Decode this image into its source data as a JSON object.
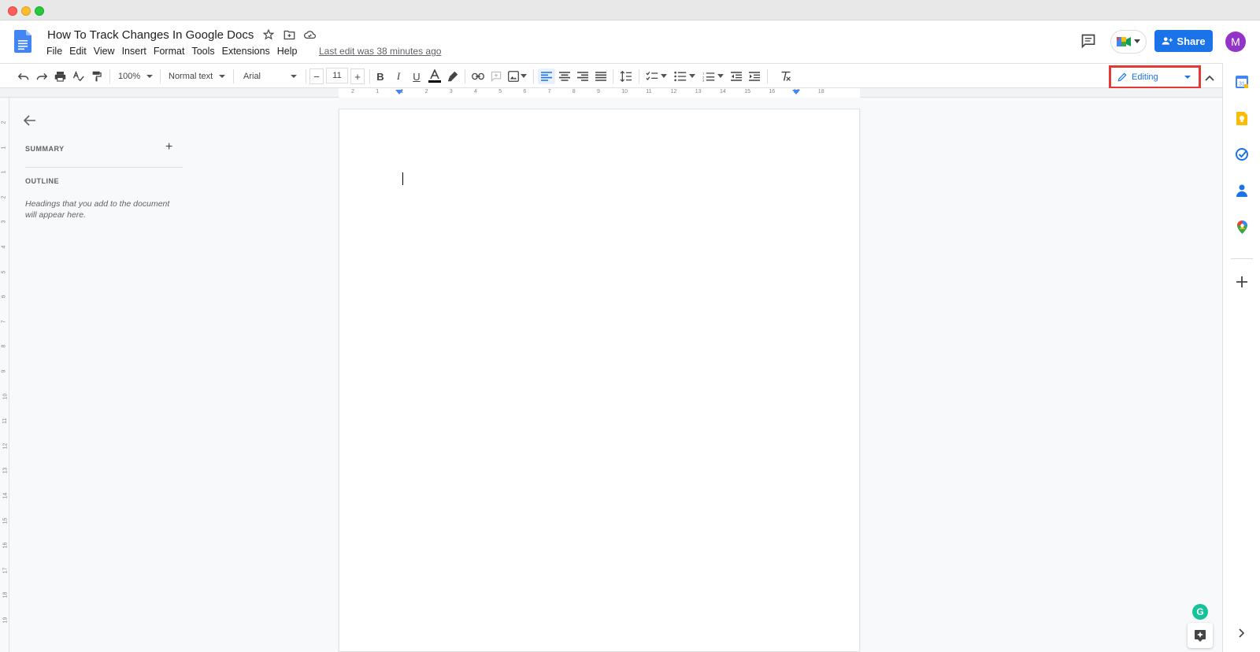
{
  "window": {
    "controls": [
      "close",
      "minimize",
      "maximize"
    ]
  },
  "header": {
    "title": "How To Track Changes In Google Docs",
    "menu": [
      "File",
      "Edit",
      "View",
      "Insert",
      "Format",
      "Tools",
      "Extensions",
      "Help"
    ],
    "last_edit": "Last edit was 38 minutes ago",
    "share_label": "Share",
    "avatar_initial": "M"
  },
  "toolbar": {
    "zoom": "100%",
    "style": "Normal text",
    "font": "Arial",
    "font_size": "11",
    "mode": "Editing",
    "active_alignment": "left"
  },
  "outline": {
    "summary_label": "SUMMARY",
    "summary_add": "+",
    "outline_label": "OUTLINE",
    "hint": "Headings that you add to the document will appear here."
  },
  "ruler": {
    "horizontal": [
      "2",
      "1",
      "1",
      "2",
      "3",
      "4",
      "5",
      "6",
      "7",
      "8",
      "9",
      "10",
      "11",
      "12",
      "13",
      "14",
      "15",
      "16",
      "17",
      "18"
    ],
    "vertical": [
      "2",
      "1",
      "1",
      "2",
      "3",
      "4",
      "5",
      "6",
      "7",
      "8",
      "9",
      "10",
      "11",
      "12",
      "13",
      "14",
      "15",
      "16",
      "17",
      "18",
      "19"
    ]
  },
  "side_panel": {
    "items": [
      "calendar-icon",
      "keep-icon",
      "tasks-icon",
      "contacts-icon",
      "maps-icon",
      "add-icon",
      "expand-icon"
    ]
  },
  "colors": {
    "accent": "#1a73e8",
    "highlight_box": "#e53935",
    "avatar": "#9334c9",
    "grammarly": "#15c39a"
  },
  "grammarly_letter": "G"
}
